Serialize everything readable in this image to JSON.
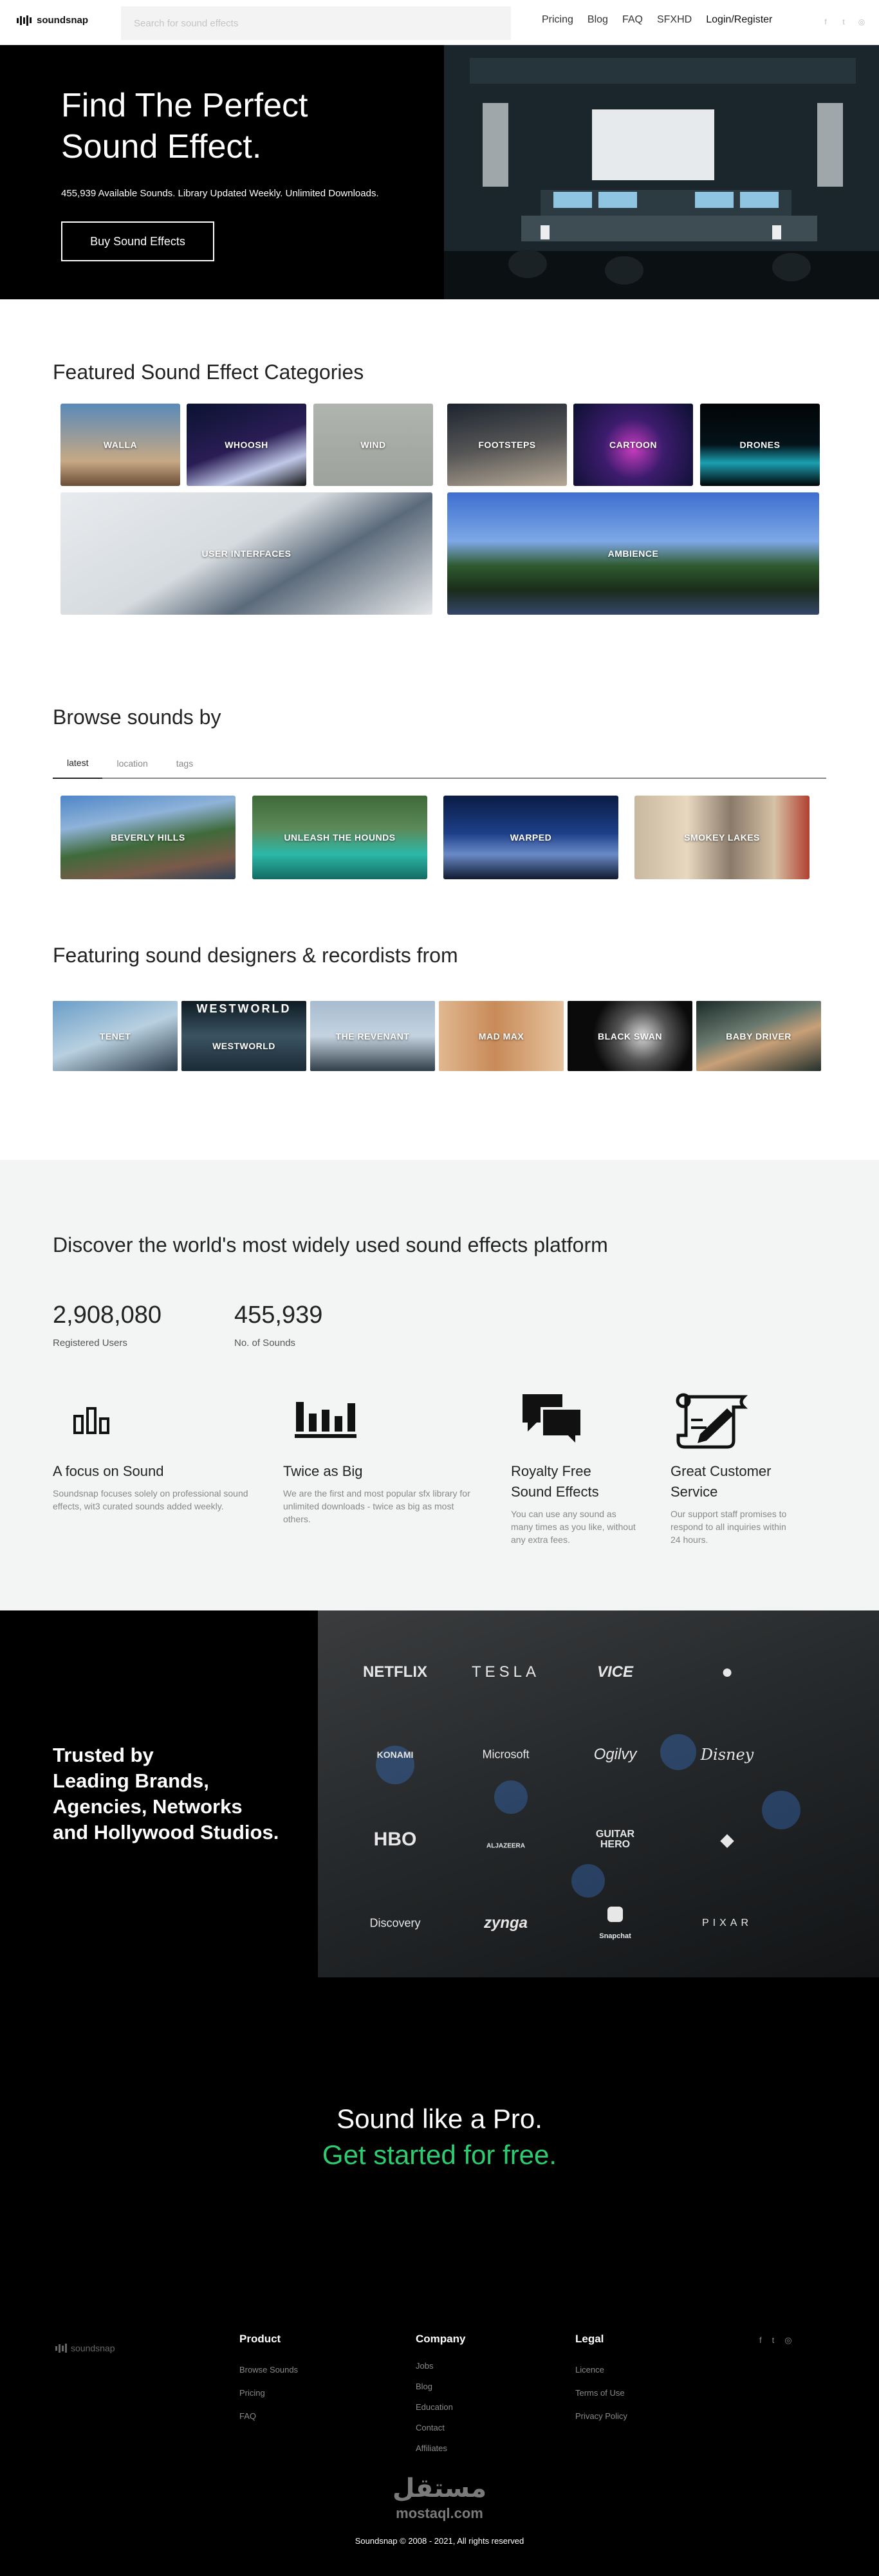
{
  "nav": {
    "logo": "soundsnap",
    "search_placeholder": "Search for sound effects",
    "links": [
      "Pricing",
      "Blog",
      "FAQ",
      "SFXHD"
    ],
    "login": "Login",
    "register": "Register"
  },
  "hero": {
    "title_line1": "Find The Perfect",
    "title_line2": "Sound Effect.",
    "subtitle": "455,939 Available Sounds. Library Updated Weekly. Unlimited Downloads.",
    "cta": "Buy Sound Effects"
  },
  "featured": {
    "title": "Featured Sound Effect Categories",
    "categories": [
      "WALLA",
      "WHOOSH",
      "WIND",
      "FOOTSTEPS",
      "CARTOON",
      "DRONES",
      "USER INTERFACES",
      "AMBIENCE"
    ]
  },
  "browse": {
    "title": "Browse sounds by",
    "tabs": [
      "latest",
      "location",
      "tags"
    ],
    "collections": [
      "BEVERLY HILLS",
      "UNLEASH THE HOUNDS",
      "WARPED",
      "SMOKEY LAKES"
    ]
  },
  "designers": {
    "title": "Featuring sound designers & recordists from",
    "films": [
      "TENET",
      "WESTWORLD",
      "THE REVENANT",
      "MAD MAX",
      "BLACK SWAN",
      "BABY DRIVER"
    ],
    "poster_text": "WESTWORLD"
  },
  "stats": {
    "title": "Discover the world's most widely used sound effects platform",
    "users_value": "2,908,080",
    "users_label": "Registered Users",
    "sounds_value": "455,939",
    "sounds_label": "No. of Sounds",
    "features": [
      {
        "title": "A focus on Sound",
        "text": "Soundsnap focuses solely on professional sound effects, wit3 curated sounds added weekly."
      },
      {
        "title": "Twice as Big",
        "text": "We are the first and most popular sfx library for unlimited downloads - twice as big as most others."
      },
      {
        "title_line1": "Royalty Free",
        "title_line2": "Sound Effects",
        "text": "You can use any sound as many times as you like, without any extra fees."
      },
      {
        "title_line1": "Great Customer",
        "title_line2": "Service",
        "text": "Our support staff promises to respond to all inquiries within 24 hours."
      }
    ]
  },
  "trusted": {
    "line1": "Trusted by",
    "line2": "Leading Brands,",
    "line3": "Agencies, Networks",
    "line4": "and Hollywood Studios.",
    "brands": [
      "NETFLIX",
      "TESLA",
      "VICE",
      "KONAMI",
      "Microsoft",
      "Ogilvy",
      "Disney",
      "HBO",
      "ALJAZEERA",
      "GUITAR HERO",
      "Discovery",
      "zynga",
      "Snapchat",
      "PIXAR"
    ]
  },
  "cta": {
    "line1": "Sound like a Pro.",
    "line2": "Get started for free."
  },
  "footer": {
    "logo": "soundsnap",
    "product_title": "Product",
    "product_links": [
      "Browse Sounds",
      "Pricing",
      "FAQ"
    ],
    "company_title": "Company",
    "company_links": [
      "Jobs",
      "Blog",
      "Education",
      "Contact",
      "Affiliates"
    ],
    "legal_title": "Legal",
    "legal_links": [
      "Licence",
      "Terms of Use",
      "Privacy Policy"
    ],
    "copyright": "Soundsnap © 2008 - 2021, All rights reserved",
    "watermark_ar": "مستقل",
    "watermark_en": "mostaql.com"
  },
  "colors": {
    "accent_green": "#2ecc71",
    "dark": "#000000",
    "stats_bg": "#f2f5f4"
  }
}
